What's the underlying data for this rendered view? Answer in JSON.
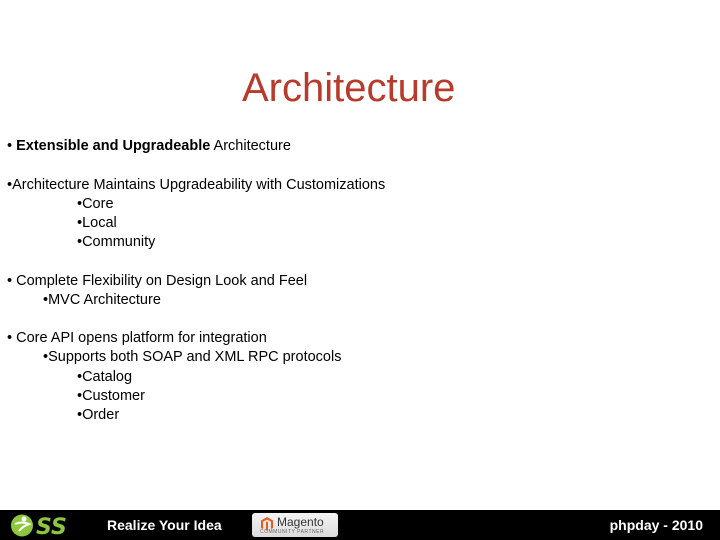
{
  "slide": {
    "title": "Architecture",
    "bullets": [
      {
        "bold": "Extensible and Upgradeable",
        "text": " Architecture"
      },
      {
        "text": "Architecture Maintains Upgradeability with Customizations",
        "children": [
          "Core",
          "Local",
          "Community"
        ]
      },
      {
        "text": "Complete Flexibility on Design Look and Feel",
        "children": [
          "MVC Architecture"
        ]
      },
      {
        "text": "Core API opens platform for integration",
        "sub": "Supports both SOAP and XML RPC protocols",
        "children": [
          "Catalog",
          "Customer",
          "Order"
        ]
      }
    ]
  },
  "footer": {
    "logo_text": "SS",
    "tagline": "Realize Your Idea",
    "partner_name": "Magento",
    "partner_sub": "COMMUNITY PARTNER",
    "event": "phpday - 2010",
    "logo_color": "#8dc63f",
    "title_color": "#b83a2b"
  },
  "bullet_char": "•"
}
